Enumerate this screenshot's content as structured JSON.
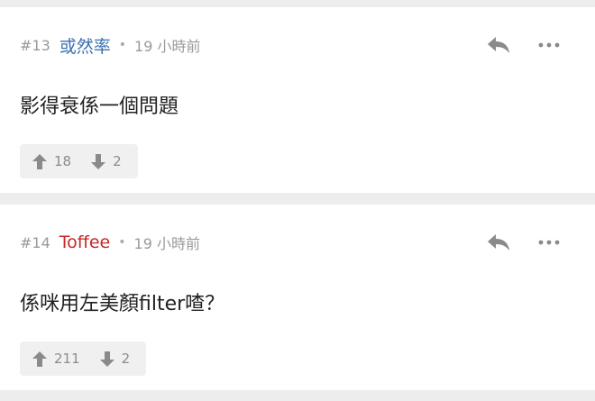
{
  "posts": [
    {
      "floor": "#13",
      "author": "或然率",
      "author_color": "#3a70b0",
      "separator": "•",
      "time": "19 小時前",
      "content": "影得衰係一個問題",
      "upvotes": "18",
      "downvotes": "2",
      "reply_icon": "reply-arrow",
      "more_icon": "ellipsis"
    },
    {
      "floor": "#14",
      "author": "Toffee",
      "author_color": "#c62828",
      "separator": "•",
      "time": "19 小時前",
      "content": "係咪用左美顏filter喳？",
      "upvotes": "211",
      "downvotes": "2",
      "reply_icon": "reply-arrow",
      "more_icon": "ellipsis"
    }
  ]
}
